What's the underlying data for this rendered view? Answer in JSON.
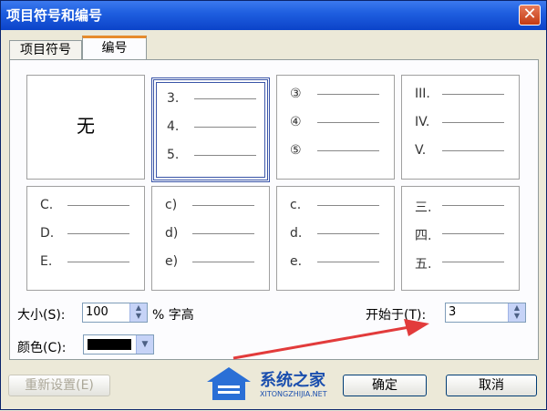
{
  "window": {
    "title": "项目符号和编号"
  },
  "tabs": [
    {
      "label": "项目符号"
    },
    {
      "label": "编号"
    }
  ],
  "none_label": "无",
  "cells": [
    {
      "markers": []
    },
    {
      "markers": [
        "3.",
        "4.",
        "5."
      ]
    },
    {
      "markers": [
        "③",
        "④",
        "⑤"
      ]
    },
    {
      "markers": [
        "III.",
        "IV.",
        "V."
      ]
    },
    {
      "markers": [
        "C.",
        "D.",
        "E."
      ]
    },
    {
      "markers": [
        "c)",
        "d)",
        "e)"
      ]
    },
    {
      "markers": [
        "c.",
        "d.",
        "e."
      ]
    },
    {
      "markers": [
        "三.",
        "四.",
        "五."
      ]
    }
  ],
  "size": {
    "label": "大小(S):",
    "value": "100",
    "unit": "% 字高"
  },
  "color": {
    "label": "颜色(C):",
    "value": "#000000"
  },
  "start_at": {
    "label": "开始于(T):",
    "value": "3"
  },
  "buttons": {
    "reset": "重新设置(E)",
    "ok": "确定",
    "cancel": "取消"
  },
  "close_symbol": "✕",
  "accent": {
    "arrow": "#e23b3b",
    "title_bar": "#0b43c9"
  },
  "watermark": {
    "text": "系统之家",
    "subtext": "XITONGZHIJIA.NET"
  }
}
